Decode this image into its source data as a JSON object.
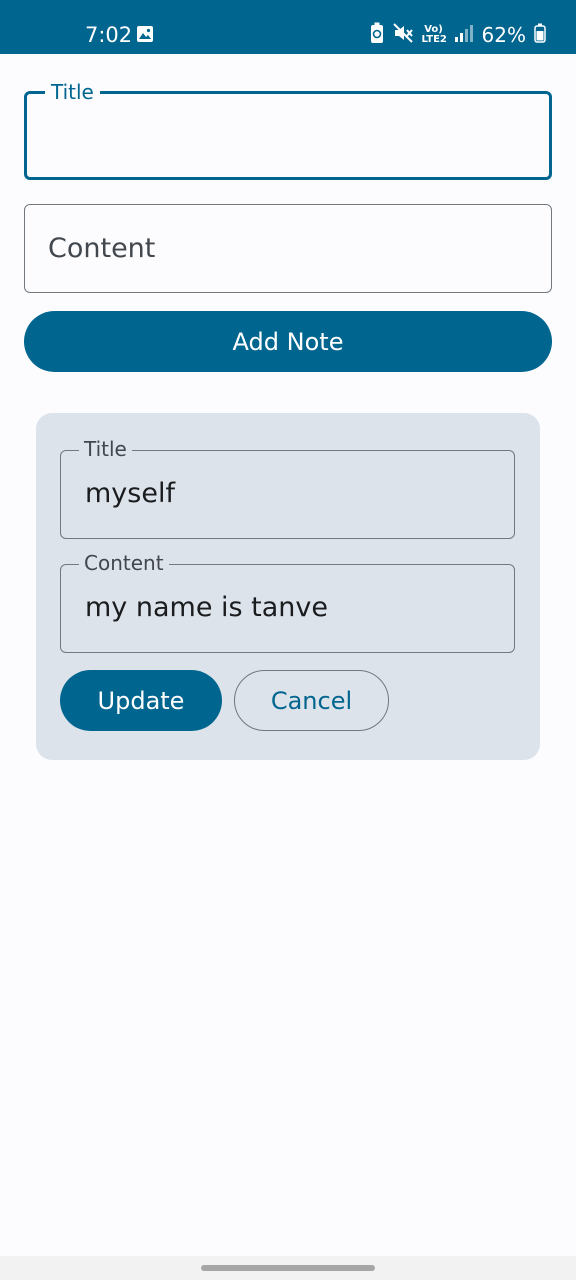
{
  "status_bar": {
    "time": "7:02",
    "network": "Vo) LTE2",
    "battery": "62%",
    "icons": [
      "image-icon",
      "battery-saver-icon",
      "mute-icon",
      "volte-icon",
      "signal-icon",
      "battery-icon"
    ]
  },
  "form": {
    "title_label": "Title",
    "content_placeholder": "Content",
    "add_button": "Add Note"
  },
  "note_card": {
    "title_label": "Title",
    "title_value": "myself",
    "content_label": "Content",
    "content_value": "my name is tanve",
    "update_button": "Update",
    "cancel_button": "Cancel"
  },
  "colors": {
    "primary": "#00658f",
    "card_background": "#dde3ea",
    "surface": "#fcfcff",
    "outline": "#72787e"
  }
}
